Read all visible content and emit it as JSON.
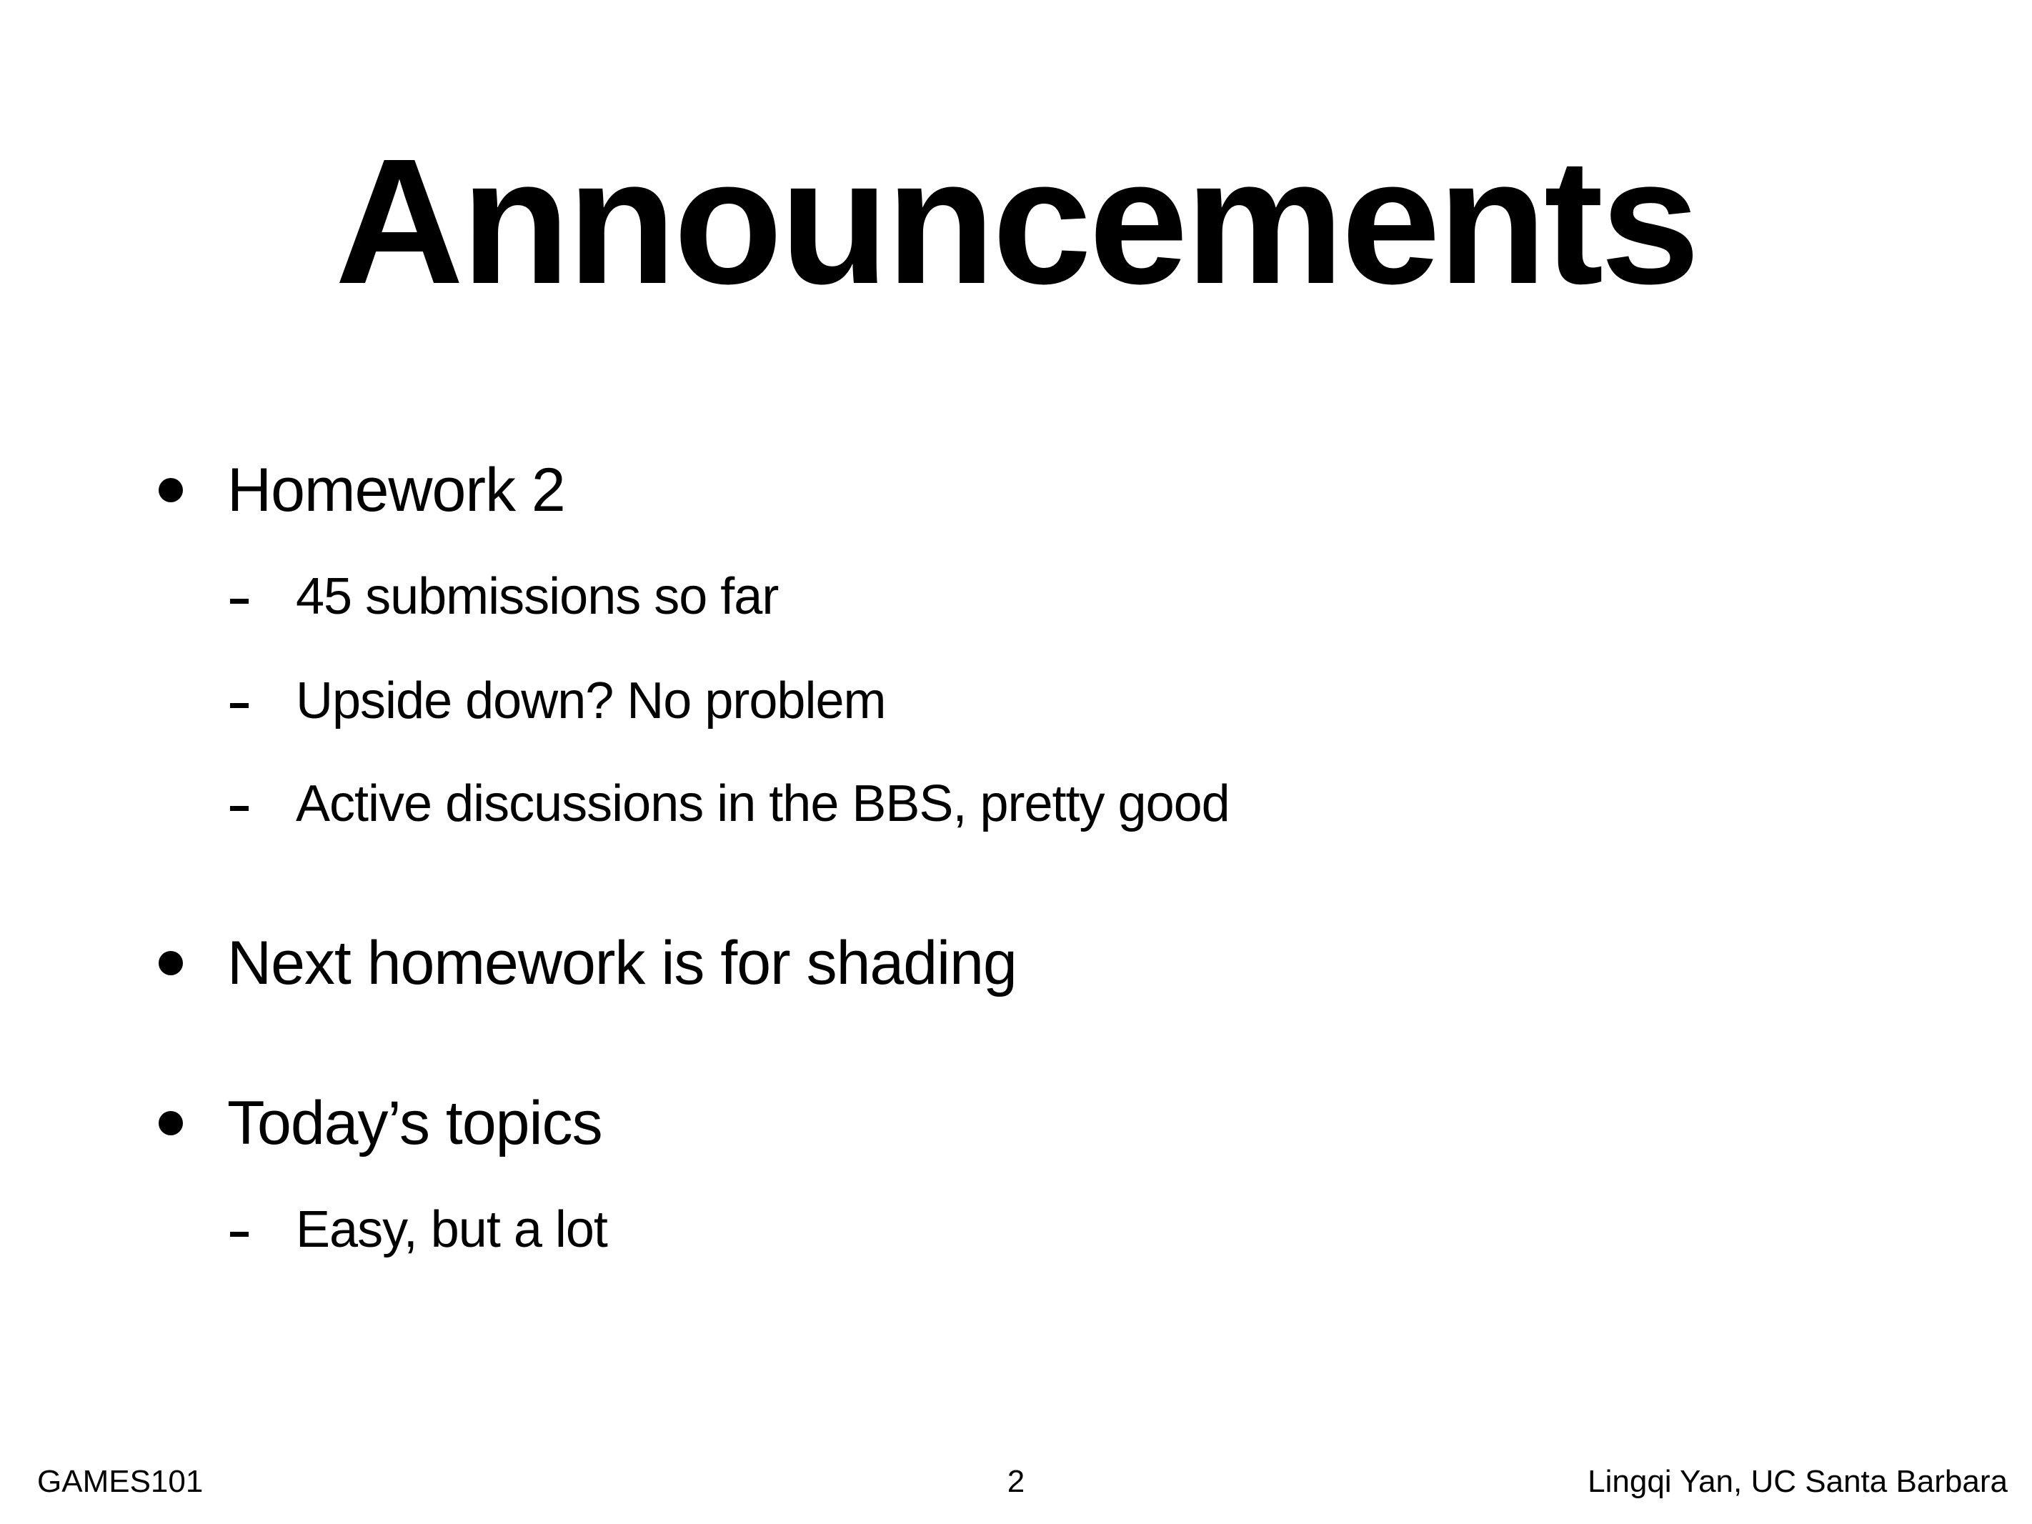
{
  "slide": {
    "title": "Announcements",
    "bullets": [
      {
        "label": "Homework 2",
        "subitems": [
          "45 submissions so far",
          "Upside down? No problem",
          "Active discussions in the BBS, pretty good"
        ]
      },
      {
        "label": "Next homework is for shading",
        "subitems": []
      },
      {
        "label": "Today’s topics",
        "subitems": [
          "Easy, but a lot"
        ]
      }
    ]
  },
  "footer": {
    "course": "GAMES101",
    "page_number": "2",
    "author": "Lingqi Yan, UC Santa Barbara"
  }
}
